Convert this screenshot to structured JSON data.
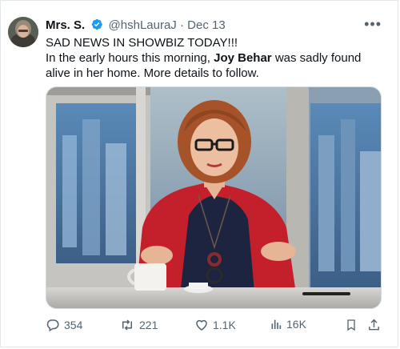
{
  "tweet": {
    "display_name": "Mrs. S.",
    "handle": "@hshLauraJ",
    "separator": "·",
    "date": "Dec 13",
    "more_label": "•••",
    "line1": "SAD NEWS IN SHOWBIZ TODAY!!!",
    "line2_before": " In the early hours this morning, ",
    "line2_bold": "Joy Behar",
    "line2_after": " was sadly found alive in her home. More details to follow."
  },
  "actions": {
    "replies": "354",
    "retweets": "221",
    "likes": "1.1K",
    "views": "16K"
  },
  "colors": {
    "verified": "#1d9bf0",
    "muted": "#536471",
    "jacket": "#c3202b"
  },
  "icons": [
    "verified-badge-icon",
    "more-icon",
    "reply-icon",
    "retweet-icon",
    "like-icon",
    "views-icon",
    "bookmark-icon",
    "share-icon"
  ]
}
